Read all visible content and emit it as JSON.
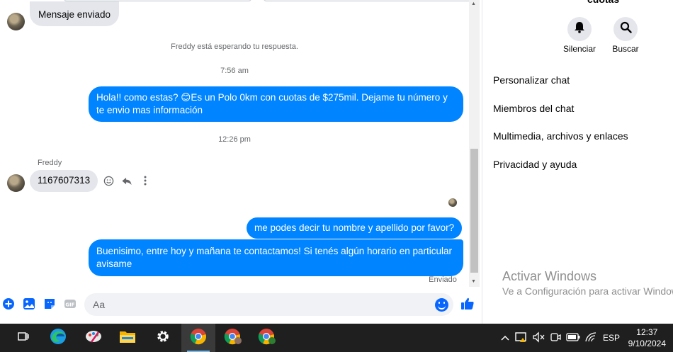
{
  "thread": {
    "first_message": "Mensaje enviado",
    "waiting_notice": "Freddy está esperando tu respuesta.",
    "time_1": "7:56 am",
    "out_msg_1": "Hola!! como estas? 😊Es un Polo 0km con cuotas de $275mil. Dejame tu número y te envio mas información",
    "time_2": "12:26 pm",
    "sender_name": "Freddy",
    "in_msg_1": "1167607313",
    "out_msg_2": "me podes decir tu nombre y apellido por favor?",
    "out_msg_3": "Buenisimo, entre hoy y mañana te contactamos! Si tenés algún horario en particular avisame",
    "status": "Enviado"
  },
  "composer": {
    "placeholder": "Aa",
    "icons": [
      "plus-circle-icon",
      "image-icon",
      "sticker-icon",
      "gif-icon",
      "emoji-icon",
      "like-icon"
    ],
    "accent_color": "#0866ff"
  },
  "info": {
    "title_cut": "cuotas",
    "mute_label": "Silenciar",
    "search_label": "Buscar",
    "menu": [
      "Personalizar chat",
      "Miembros del chat",
      "Multimedia, archivos y enlaces",
      "Privacidad y ayuda"
    ]
  },
  "watermark": {
    "line1": "Activar Windows",
    "line2": "Ve a Configuración para activar Windows."
  },
  "taskbar": {
    "apps": [
      "task-view-icon",
      "edge-icon",
      "paint-icon",
      "file-explorer-icon",
      "settings-icon",
      "chrome-icon",
      "chrome-profile-icon",
      "chrome-profile-t-icon"
    ],
    "language": "ESP",
    "time": "12:37",
    "date": "9/10/2024"
  },
  "colors": {
    "outgoing_bubble": "#0084ff",
    "incoming_bubble": "#e4e6eb",
    "taskbar": "#1f1f1f"
  }
}
